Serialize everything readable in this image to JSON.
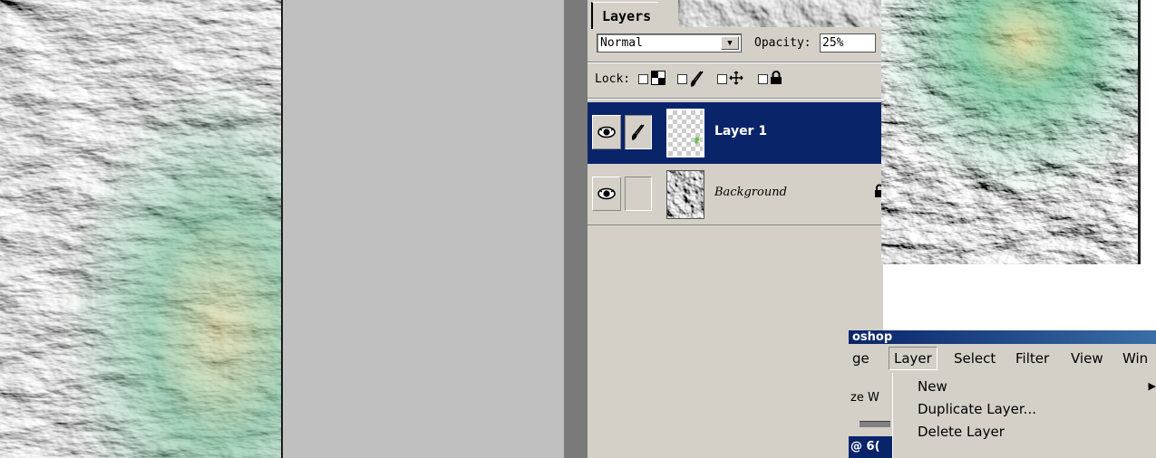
{
  "layers_panel": {
    "tab_label": "Layers",
    "blend_mode": "Normal",
    "opacity_label": "Opacity:",
    "opacity_value": "25%",
    "lock_label": "Lock:",
    "layers": [
      {
        "name": "Layer 1",
        "selected": true,
        "visible": true,
        "transparent": true
      },
      {
        "name": "Background",
        "selected": false,
        "visible": true,
        "locked": true
      }
    ]
  },
  "app": {
    "title_fragment": "oshop"
  },
  "menubar": {
    "items": [
      "ge",
      "Layer",
      "Select",
      "Filter",
      "View",
      "Win"
    ],
    "open_item": "Layer"
  },
  "layer_menu": {
    "items": [
      "New",
      "Duplicate Layer...",
      "Delete Layer"
    ]
  },
  "document_strip": {
    "text_fragment": "ze W",
    "tab_fragment": "@ 6("
  },
  "colors": {
    "selection": "#0a246a",
    "panel": "#d4d0c8",
    "canvas": "#c0c0c0"
  }
}
